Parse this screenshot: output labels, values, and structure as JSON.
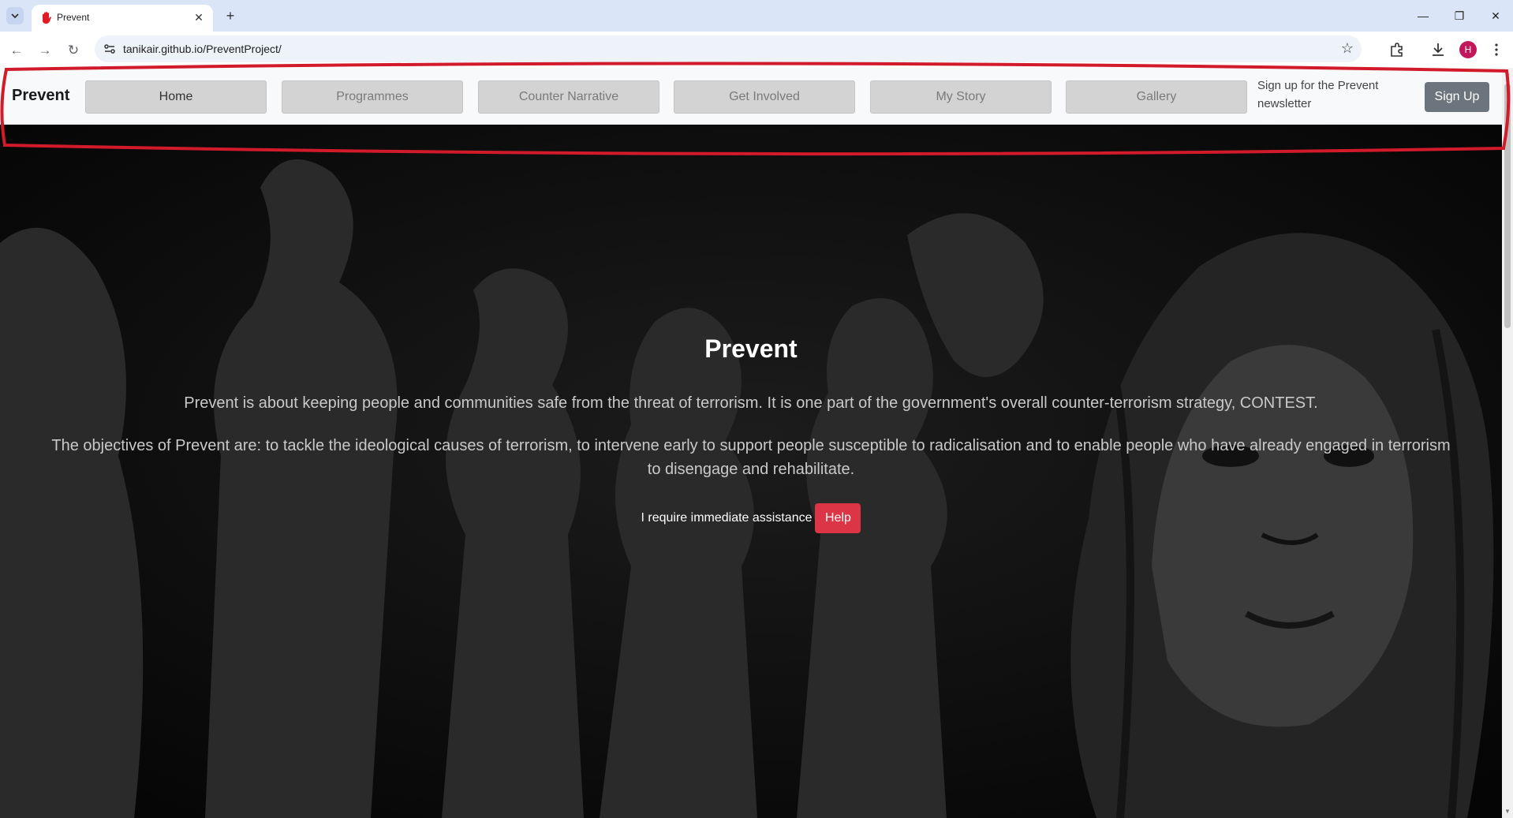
{
  "browser": {
    "tab_title": "Prevent",
    "url": "tanikair.github.io/PreventProject/",
    "profile_initial": "H"
  },
  "nav": {
    "brand": "Prevent",
    "links": [
      "Home",
      "Programmes",
      "Counter Narrative",
      "Get Involved",
      "My Story",
      "Gallery"
    ],
    "active_index": 0,
    "newsletter_text": "Sign up for the Prevent newsletter",
    "signup_label": "Sign Up"
  },
  "hero": {
    "title": "Prevent",
    "paragraph1": "Prevent is about keeping people and communities safe from the threat of terrorism. It is one part of the government's overall counter-terrorism strategy, CONTEST.",
    "paragraph2": "The objectives of Prevent are: to tackle the ideological causes of terrorism, to intervene early to support people susceptible to radicalisation and to enable people who have already engaged in terrorism to disengage and rehabilitate.",
    "assist_label": "I require immediate assistance",
    "help_label": "Help"
  },
  "colors": {
    "navbar_bg": "#f8f9fa",
    "nav_link_bg": "#d3d3d3",
    "signup_bg": "#6c757d",
    "help_bg": "#dc3545",
    "highlight": "#d11a2a"
  }
}
